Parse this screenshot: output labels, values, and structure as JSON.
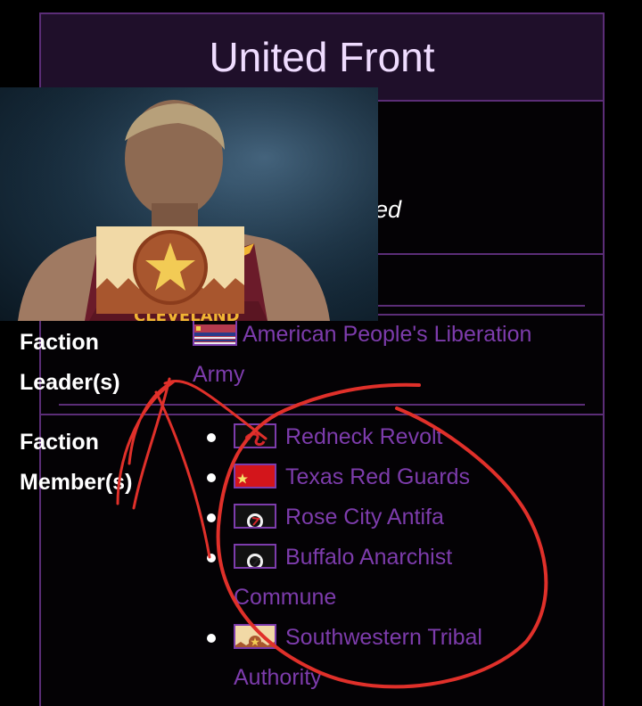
{
  "infobox": {
    "title": "United Front",
    "partial_subtitle": "United",
    "leader_label": "Faction Leader(s)",
    "leader_link": "American People's Liberation Army",
    "members_label": "Faction Member(s)",
    "members": [
      {
        "name": "Redneck Revolt",
        "flag_icon": "red-snake-flag-icon"
      },
      {
        "name": "Texas Red Guards",
        "flag_icon": "red-star-flag-icon"
      },
      {
        "name": "Rose City Antifa",
        "flag_icon": "antifa-flag-icon"
      },
      {
        "name": "Buffalo Anarchist Commune",
        "flag_icon": "antifa-flag-icon"
      },
      {
        "name": "Southwestern Tribal Authority",
        "flag_icon": "tribal-star-flag-icon"
      }
    ]
  },
  "overlay": {
    "description_icon": "basketball-player-photo-with-tribal-flag",
    "annotation_color": "#e0302a"
  },
  "colors": {
    "link": "#7d3cac",
    "border": "#5b2d77",
    "title_bg": "#1f0f2a",
    "title_text": "#efdcff"
  }
}
